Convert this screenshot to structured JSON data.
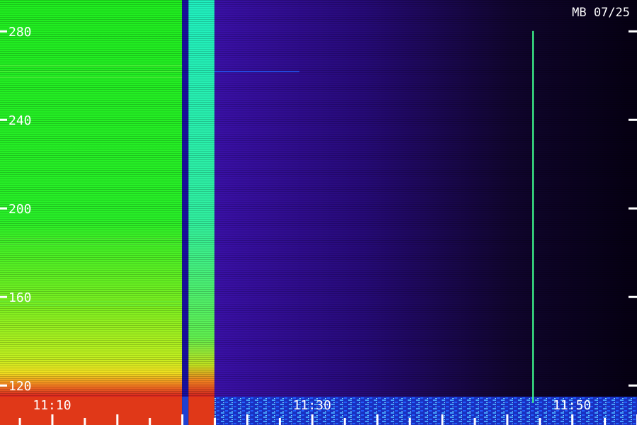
{
  "chart_data": {
    "type": "heatmap",
    "title": "MB 07/25",
    "xlabel": "",
    "ylabel": "",
    "y_axis": {
      "range": [
        102,
        294
      ],
      "tick_labels": [
        "280",
        "240",
        "200",
        "160",
        "120"
      ]
    },
    "x_axis": {
      "range": [
        "11:06",
        "11:55"
      ],
      "tick_labels": [
        "11:10",
        "11:30",
        "11:50"
      ]
    },
    "colormap": [
      "#000000",
      "#2a0a6a",
      "#3a1aa0",
      "#2040ff",
      "#20c0ff",
      "#20ffb0",
      "#30ff30",
      "#a0ff20",
      "#ffe020",
      "#ff8020",
      "#e02020"
    ],
    "spectrum_segments": [
      {
        "start": "11:06",
        "end": "11:20",
        "level": "high",
        "color": "#18f018"
      },
      {
        "start": "11:20",
        "end": "11:20:30",
        "level": "low",
        "color": "#1a10a0"
      },
      {
        "start": "11:20:30",
        "end": "11:22:30",
        "level": "high",
        "color": "#28f0b0"
      },
      {
        "start": "11:22:30",
        "end": "11:55",
        "level": "background",
        "color": "#2a0a6a"
      }
    ],
    "bursts": [
      {
        "time": "11:47",
        "freq_range": [
          112,
          280
        ],
        "color": "#40ff90"
      }
    ],
    "grid": false
  }
}
